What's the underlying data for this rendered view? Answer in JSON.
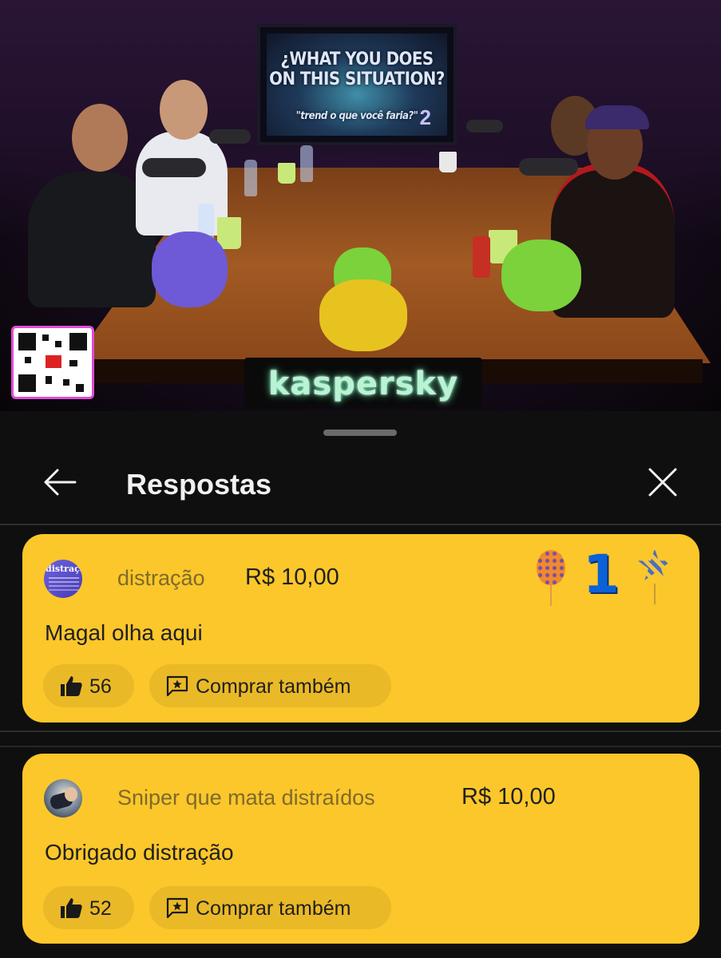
{
  "video": {
    "screen_line1": "¿WHAT YOU DOES",
    "screen_line1b": "ON THIS SITUATION?",
    "screen_line2": "\"trend o que você faria?\"",
    "screen_number": "2",
    "sponsor_sign": "kaspersky"
  },
  "sheet": {
    "title": "Respostas",
    "back_icon": "arrow-left-icon",
    "close_icon": "close-icon"
  },
  "comments": [
    {
      "avatar_text": "distração",
      "author": "distração",
      "amount": "R$ 10,00",
      "message": "Magal olha aqui",
      "likes": "56",
      "buy_label": "Comprar também",
      "badge": "1",
      "highlight_color": "#fcc72a"
    },
    {
      "author": "Sniper que mata distraídos",
      "amount": "R$ 10,00",
      "message": "Obrigado distração",
      "likes": "52",
      "buy_label": "Comprar também",
      "highlight_color": "#fcc72a"
    }
  ]
}
